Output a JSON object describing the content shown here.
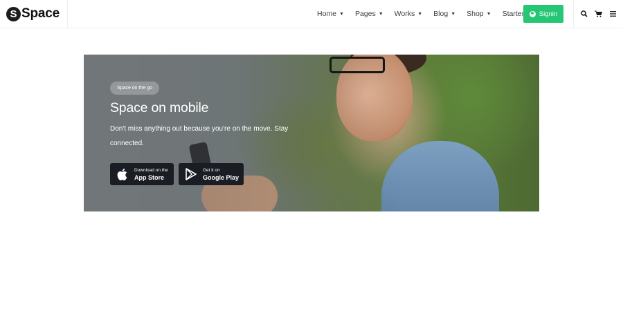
{
  "brand": {
    "mark": "S",
    "name": "Space"
  },
  "nav": {
    "items": [
      {
        "label": "Home",
        "dropdown": true
      },
      {
        "label": "Pages",
        "dropdown": true
      },
      {
        "label": "Works",
        "dropdown": true
      },
      {
        "label": "Blog",
        "dropdown": true
      },
      {
        "label": "Shop",
        "dropdown": true
      },
      {
        "label": "Starter",
        "dropdown": false
      }
    ],
    "caret": "⌄"
  },
  "signin": {
    "label": "Signin",
    "color": "#25c774"
  },
  "tools": [
    "search-icon",
    "cart-icon",
    "menu-icon"
  ],
  "hero": {
    "badge": "Space on the go",
    "title": "Space on mobile",
    "description": "Don't miss anything out because you're on the move. Stay connected.",
    "app_store": {
      "small": "Download on the",
      "big": "App Store"
    },
    "google_play": {
      "small": "Get it on",
      "big": "Google Play"
    }
  }
}
